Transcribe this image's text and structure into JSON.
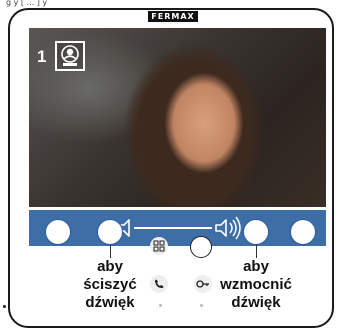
{
  "header": {
    "top_text": "g y  [ ... ]   y"
  },
  "brand": {
    "name": "FERMAX"
  },
  "screen": {
    "camera_number": "1"
  },
  "volume": {
    "decrease_icon": "speaker-low-icon",
    "increase_icon": "speaker-high-icon"
  },
  "labels": {
    "left": [
      "aby",
      "ściszyć",
      "dźwięk"
    ],
    "right": [
      "aby",
      "wzmocnić",
      "dźwięk"
    ]
  },
  "colors": {
    "volume_bar": "#3d6ea5",
    "button_outline": "#2d5aa0"
  }
}
